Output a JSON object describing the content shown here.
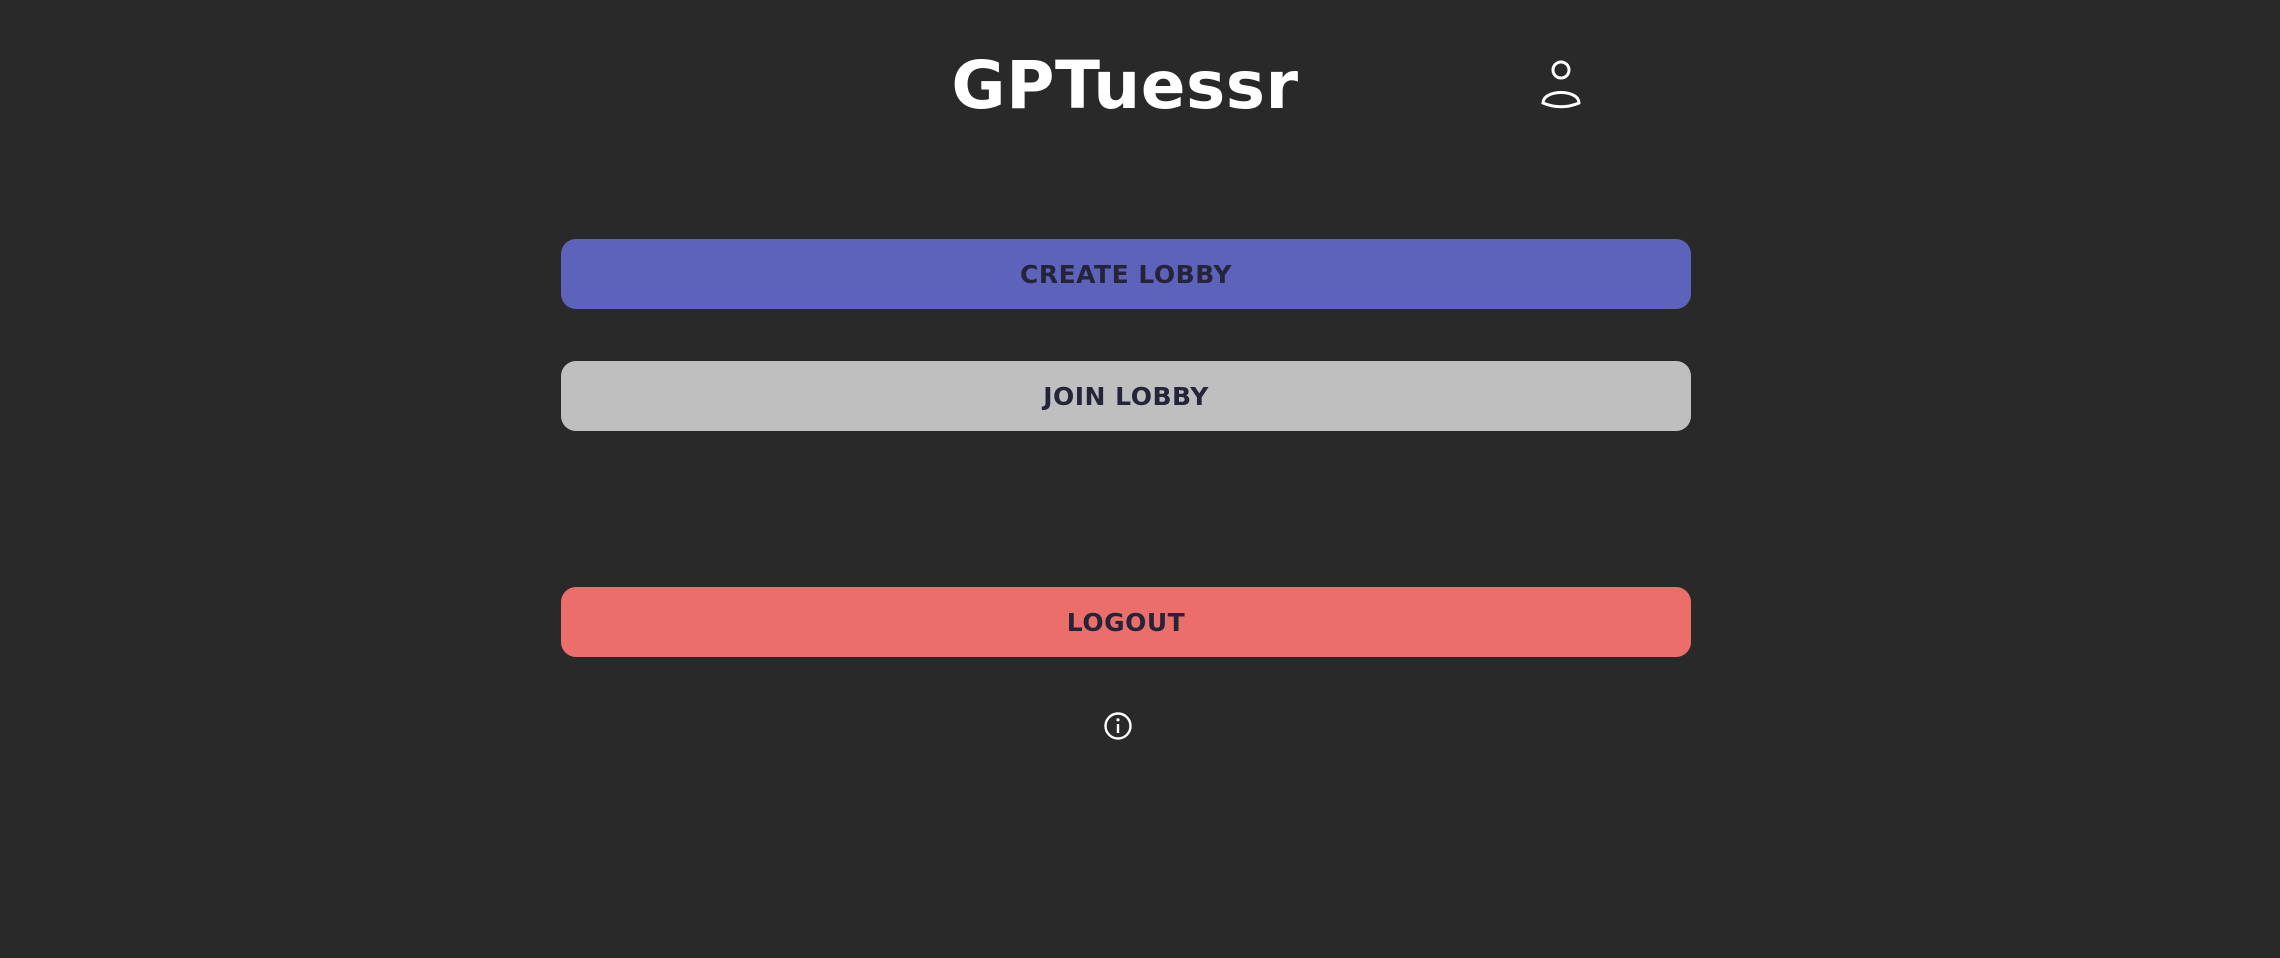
{
  "app": {
    "title": "GPTuessr"
  },
  "header": {
    "profile_icon": "user-profile-icon"
  },
  "menu": {
    "create_lobby_label": "CREATE LOBBY",
    "join_lobby_label": "JOIN LOBBY",
    "logout_label": "LOGOUT"
  },
  "footer": {
    "info_icon": "info-icon"
  },
  "colors": {
    "background": "#292929",
    "create_lobby": "#5d62bb",
    "join_lobby": "#bfbfbf",
    "logout": "#ec6e6b",
    "button_text": "#25253a",
    "title_text": "#ffffff"
  }
}
